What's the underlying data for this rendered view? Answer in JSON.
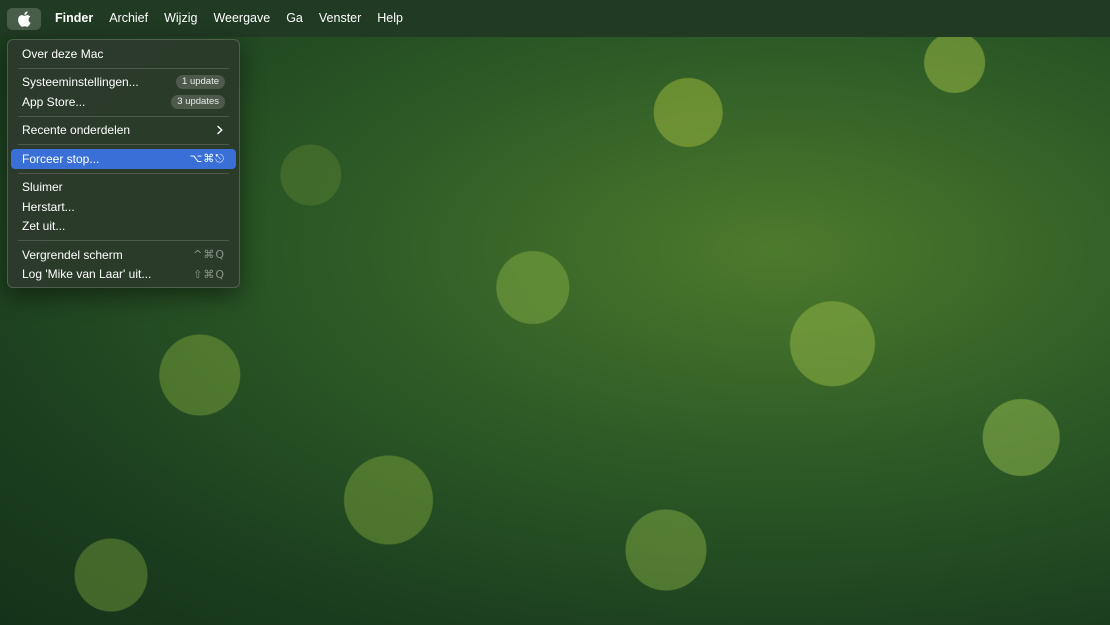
{
  "menubar": {
    "items": [
      "Finder",
      "Archief",
      "Wijzig",
      "Weergave",
      "Ga",
      "Venster",
      "Help"
    ]
  },
  "apple_menu": {
    "about": "Over deze Mac",
    "system_settings": "Systeeminstellingen...",
    "system_settings_badge": "1 update",
    "app_store": "App Store...",
    "app_store_badge": "3 updates",
    "recent_items": "Recente onderdelen",
    "force_quit": "Forceer stop...",
    "force_quit_shortcut": "⌥⌘⎋",
    "sleep": "Sluimer",
    "restart": "Herstart...",
    "shut_down": "Zet uit...",
    "lock_screen": "Vergrendel scherm",
    "lock_screen_shortcut": "^⌘Q",
    "log_out": "Log 'Mike van Laar' uit...",
    "log_out_shortcut": "⇧⌘Q"
  },
  "icons": {
    "apple": "apple-logo-icon",
    "submenu": "chevron-right-icon"
  },
  "colors": {
    "highlight": "#3a6fd8",
    "menubar": "#203a23"
  }
}
